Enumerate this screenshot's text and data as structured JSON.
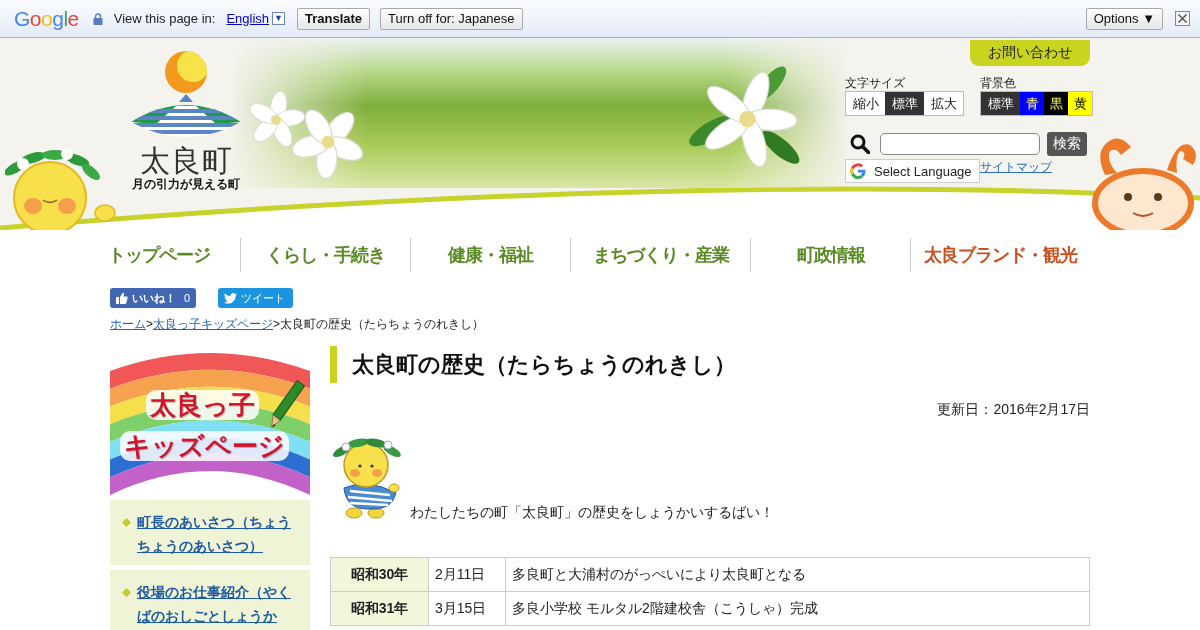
{
  "translate_bar": {
    "logo": "Google",
    "prompt": "View this page in:",
    "language": "English",
    "language_dropdown": "▼",
    "translate_button": "Translate",
    "turn_off_button": "Turn off for: Japanese",
    "options_button": "Options ▼"
  },
  "header": {
    "logo": {
      "name": "太良町",
      "tagline": "月の引力が見える町"
    },
    "contact_button": "お問い合わせ",
    "font_size": {
      "label": "文字サイズ",
      "options": [
        {
          "label": "縮小",
          "selected": false
        },
        {
          "label": "標準",
          "selected": true
        },
        {
          "label": "拡大",
          "selected": false
        }
      ]
    },
    "background_color": {
      "label": "背景色",
      "options": [
        {
          "label": "標準",
          "selected": true,
          "color": "#333333"
        },
        {
          "label": "青",
          "selected": false,
          "color": "#0000ff"
        },
        {
          "label": "黒",
          "selected": false,
          "color": "#000000"
        },
        {
          "label": "黄",
          "selected": false,
          "color": "#ffff00"
        }
      ]
    },
    "search_button": "検索",
    "language_select": "Select Language",
    "sitemap_link": "サイトマップ"
  },
  "nav": [
    {
      "label": "トップページ",
      "color": "#5a8a23"
    },
    {
      "label": "くらし・手続き",
      "color": "#5a8a23"
    },
    {
      "label": "健康・福祉",
      "color": "#5a8a23"
    },
    {
      "label": "まちづくり・産業",
      "color": "#5a8a23"
    },
    {
      "label": "町政情報",
      "color": "#5a8a23"
    },
    {
      "label": "太良ブランド・観光",
      "color": "#c8501e"
    }
  ],
  "social": {
    "like_label": "いいね！",
    "like_count": "0",
    "tweet_button": "ツイート"
  },
  "breadcrumb": [
    {
      "kind": "link",
      "text": "ホーム"
    },
    {
      "kind": "separator",
      "text": ">"
    },
    {
      "kind": "link",
      "text": "太良っ子キッズページ"
    },
    {
      "kind": "separator",
      "text": ">"
    },
    {
      "kind": "current",
      "text": "太良町の歴史（たらちょうのれきし）"
    }
  ],
  "sidebar": {
    "banner": {
      "title": "太良っ子",
      "subtitle": "キッズページ"
    },
    "items": [
      {
        "label": "町長のあいさつ（ちょうちょうのあいさつ）"
      },
      {
        "label": "役場のお仕事紹介（やくばのおしごとしょうか"
      }
    ]
  },
  "article": {
    "title": "太良町の歴史（たらちょうのれきし）",
    "updated": "更新日：2016年2月17日",
    "intro": "わたしたちの町「太良町」の歴史をしょうかいするばい！",
    "table": {
      "rows": [
        {
          "cells": [
            "昭和30年",
            "2月11日",
            "多良町と大浦村のがっぺいにより太良町となる"
          ]
        },
        {
          "cells": [
            "昭和31年",
            "3月15日",
            "多良小学校 モルタル2階建校舎（こうしゃ）完成"
          ]
        }
      ]
    }
  }
}
